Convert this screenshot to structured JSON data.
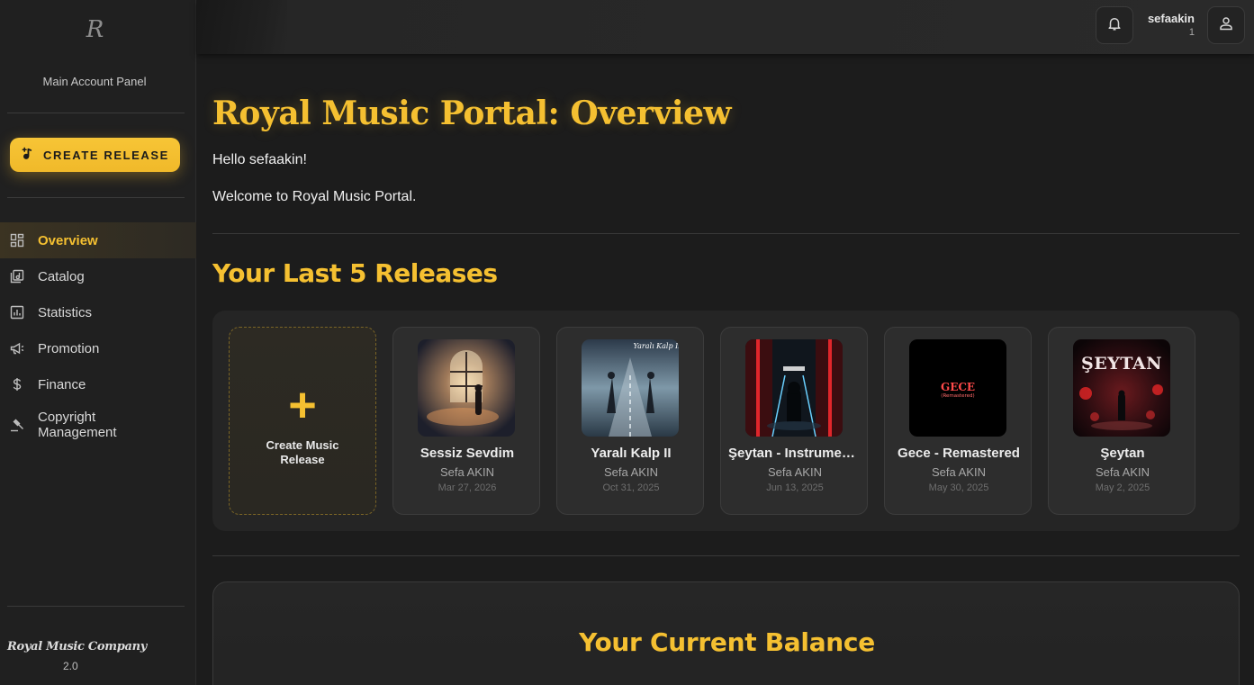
{
  "sidebar": {
    "logo_text": "R",
    "account_panel": "Main Account Panel",
    "create_release_label": "CREATE RELEASE",
    "nav": [
      {
        "label": "Overview",
        "icon": "dashboard-icon",
        "active": true
      },
      {
        "label": "Catalog",
        "icon": "catalog-icon",
        "active": false
      },
      {
        "label": "Statistics",
        "icon": "statistics-icon",
        "active": false
      },
      {
        "label": "Promotion",
        "icon": "megaphone-icon",
        "active": false
      },
      {
        "label": "Finance",
        "icon": "dollar-icon",
        "active": false
      },
      {
        "label": "Copyright Management",
        "icon": "gavel-icon",
        "active": false
      }
    ],
    "company": "Royal Music Company",
    "version": "2.0"
  },
  "topbar": {
    "username": "sefaakin",
    "user_count": "1",
    "bell_icon": "bell-icon",
    "user_icon": "user-icon"
  },
  "main": {
    "title": "Royal Music Portal: Overview",
    "hello": "Hello sefaakin!",
    "welcome": "Welcome to Royal Music Portal.",
    "releases_title": "Your Last 5 Releases",
    "create_card_label": "Create Music Release",
    "releases": [
      {
        "title": "Sessiz Sevdim",
        "artist": "Sefa AKIN",
        "date": "Mar 27, 2026"
      },
      {
        "title": "Yaralı Kalp II",
        "artist": "Sefa AKIN",
        "date": "Oct 31, 2025"
      },
      {
        "title": "Şeytan - Instrumental",
        "artist": "Sefa AKIN",
        "date": "Jun 13, 2025"
      },
      {
        "title": "Gece - Remastered",
        "artist": "Sefa AKIN",
        "date": "May 30, 2025"
      },
      {
        "title": "Şeytan",
        "artist": "Sefa AKIN",
        "date": "May 2, 2025"
      }
    ],
    "cover_texts": {
      "yarali": "Yaralı Kalp II",
      "gece": "GECE",
      "gece_sub": "(Remastered)",
      "seytan": "ŞEYTAN"
    },
    "balance_title": "Your Current Balance"
  },
  "colors": {
    "accent": "#f5c031",
    "background": "#1c1c1c",
    "sidebar": "#202020"
  }
}
